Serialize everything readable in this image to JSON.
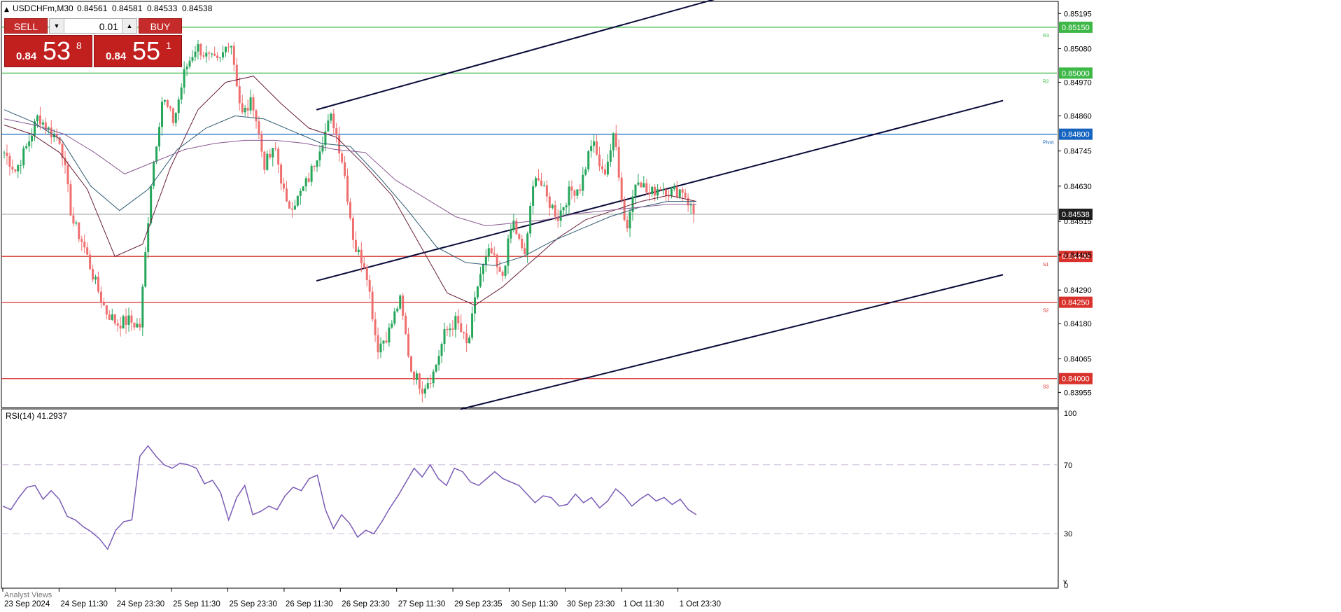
{
  "chart_header": {
    "symbol_line": "USDCHFm,M30",
    "ohlc": [
      "0.84561",
      "0.84581",
      "0.84533",
      "0.84538"
    ]
  },
  "trade_panel": {
    "sell_label": "SELL",
    "buy_label": "BUY",
    "lot_value": "0.01",
    "sell_price": {
      "small": "0.84",
      "big": "53",
      "sup": "8"
    },
    "buy_price": {
      "small": "0.84",
      "big": "55",
      "sup": "1"
    }
  },
  "colors": {
    "bull": "#26a65b",
    "bear": "#ef6f6f",
    "resistance": "#3db847",
    "support": "#d9312b",
    "pivot": "#1565c0",
    "bid_line": "#9e9e9e",
    "channel": "#0a0a3a",
    "ma_fast": "#6a1f3c",
    "ma_mid": "#2e5b70",
    "ma_slow": "#8a5a94",
    "rsi": "#7a5bb5"
  },
  "chart_data": [
    {
      "type": "candlestick",
      "symbol": "USDCHFm",
      "timeframe": "M30",
      "ylim": [
        0.8391,
        0.8523
      ],
      "price_labels": [
        "0.85195",
        "0.85080",
        "0.84970",
        "0.84860",
        "0.84745",
        "0.84630",
        "0.84515",
        "0.84405",
        "0.84290",
        "0.84180",
        "0.84065",
        "0.83955"
      ],
      "current_price": "0.84538",
      "levels": [
        {
          "name": "R3",
          "value": "0.85150",
          "kind": "resistance"
        },
        {
          "name": "R2",
          "value": "0.85000",
          "kind": "resistance"
        },
        {
          "name": "Pivot",
          "value": "0.84800",
          "kind": "pivot"
        },
        {
          "name": "S1",
          "value": "0.84400",
          "kind": "support"
        },
        {
          "name": "S2",
          "value": "0.84250",
          "kind": "support"
        },
        {
          "name": "S3",
          "value": "0.84000",
          "kind": "support"
        }
      ],
      "x_labels": [
        "23 Sep 2024",
        "24 Sep 11:30",
        "24 Sep 23:30",
        "25 Sep 11:30",
        "25 Sep 23:30",
        "26 Sep 11:30",
        "26 Sep 23:30",
        "27 Sep 11:30",
        "29 Sep 23:35",
        "30 Sep 11:30",
        "30 Sep 23:30",
        "1 Oct 11:30",
        "1 Oct 23:30"
      ],
      "close_path": [
        0.8474,
        0.8468,
        0.8476,
        0.8486,
        0.8481,
        0.8478,
        0.8452,
        0.8444,
        0.8432,
        0.8422,
        0.8418,
        0.8419,
        0.8417,
        0.8465,
        0.8492,
        0.8484,
        0.8501,
        0.8509,
        0.8505,
        0.8503,
        0.8512,
        0.8486,
        0.8491,
        0.847,
        0.8475,
        0.8456,
        0.8459,
        0.8466,
        0.8477,
        0.8486,
        0.847,
        0.8443,
        0.8437,
        0.841,
        0.8415,
        0.8426,
        0.8403,
        0.8397,
        0.8402,
        0.8415,
        0.8419,
        0.841,
        0.8433,
        0.8442,
        0.8432,
        0.8452,
        0.8439,
        0.8468,
        0.8459,
        0.8453,
        0.8461,
        0.8463,
        0.8478,
        0.8466,
        0.848,
        0.8448,
        0.8467,
        0.846,
        0.8463,
        0.8461,
        0.8462,
        0.8454
      ],
      "moving_averages": [
        {
          "name": "MA fast",
          "path": [
            0.8483,
            0.848,
            0.8474,
            0.8462,
            0.844,
            0.8444,
            0.8469,
            0.8488,
            0.8497,
            0.8499,
            0.849,
            0.8482,
            0.8479,
            0.847,
            0.846,
            0.8444,
            0.8428,
            0.8424,
            0.843,
            0.8438,
            0.8446,
            0.8452,
            0.8455,
            0.8458,
            0.846,
            0.8458
          ]
        },
        {
          "name": "MA mid",
          "path": [
            0.8488,
            0.8484,
            0.8478,
            0.8463,
            0.8455,
            0.8462,
            0.8475,
            0.8482,
            0.8486,
            0.8485,
            0.8481,
            0.8477,
            0.8476,
            0.8466,
            0.8455,
            0.8443,
            0.8438,
            0.8437,
            0.844,
            0.8445,
            0.8449,
            0.8453,
            0.8456,
            0.8458,
            0.8458
          ]
        },
        {
          "name": "MA slow",
          "path": [
            0.8485,
            0.8483,
            0.848,
            0.8474,
            0.8467,
            0.8471,
            0.8475,
            0.8477,
            0.8478,
            0.8478,
            0.8477,
            0.8475,
            0.8474,
            0.8465,
            0.8459,
            0.8453,
            0.845,
            0.8451,
            0.8452,
            0.8454,
            0.8455,
            0.8456,
            0.8457,
            0.8457
          ]
        }
      ],
      "channel_lines": [
        {
          "from": [
            0.2985,
            0.8488
          ],
          "to": [
            0.716,
            0.8528
          ]
        },
        {
          "from": [
            0.2985,
            0.8432
          ],
          "to": [
            0.949,
            0.8491
          ]
        },
        {
          "from": [
            0.435,
            0.839
          ],
          "to": [
            0.949,
            0.8434
          ]
        }
      ],
      "grid": false
    },
    {
      "type": "line",
      "title": "RSI(14) 41.2937",
      "ylim": [
        0,
        100
      ],
      "y_ticks": [
        "100",
        "70",
        "30",
        "0"
      ],
      "levels": [
        70,
        30
      ],
      "values": [
        46,
        44,
        51,
        57,
        58,
        50,
        55,
        50,
        40,
        38,
        34,
        31,
        27,
        21,
        32,
        37,
        38,
        75,
        81,
        75,
        70,
        68,
        71,
        70,
        68,
        59,
        61,
        54,
        38,
        51,
        58,
        41,
        43,
        46,
        44,
        52,
        57,
        55,
        62,
        64,
        44,
        33,
        41,
        36,
        28,
        32,
        30,
        37,
        45,
        52,
        60,
        68,
        63,
        70,
        62,
        58,
        68,
        66,
        60,
        58,
        62,
        66,
        62,
        60,
        58,
        53,
        48,
        52,
        51,
        46,
        47,
        53,
        48,
        51,
        45,
        49,
        56,
        52,
        46,
        50,
        53,
        49,
        51,
        47,
        50,
        44,
        41
      ]
    }
  ],
  "bottom_tab": "Analyst Views"
}
